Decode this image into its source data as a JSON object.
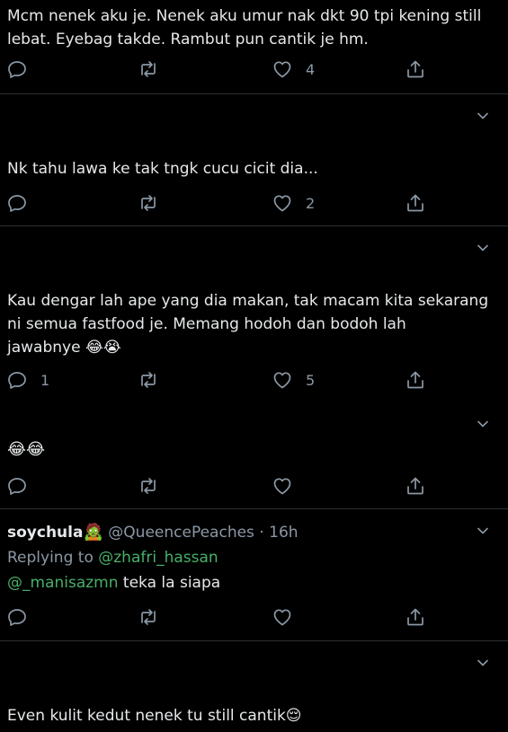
{
  "tweets": [
    {
      "lines": [
        "Mcm nenek aku je. Nenek aku umur nak dkt 90 tpi kening still",
        "lebat. Eyebag takde. Rambut pun cantik je hm."
      ],
      "reply_count": "",
      "like_count": "4"
    },
    {
      "lines": [
        "Nk tahu lawa ke tak tngk cucu cicit dia..."
      ],
      "reply_count": "",
      "like_count": "2"
    },
    {
      "lines": [
        "Kau dengar lah ape yang dia makan, tak macam kita sekarang",
        "ni semua fastfood je. Memang hodoh dan bodoh lah",
        "jawabnye 😂😭"
      ],
      "reply_count": "1",
      "like_count": "5"
    },
    {
      "lines": [
        "😂😂"
      ],
      "reply_count": "",
      "like_count": ""
    },
    {
      "author_name": "soychula",
      "author_badge": "🧟",
      "author_handle": "@QueencePeaches",
      "time": "· 16h",
      "replying_label": "Replying to",
      "replying_to": "@zhafri_hassan",
      "mention": "@_manisazmn",
      "body": " teka la siapa",
      "reply_count": "",
      "like_count": ""
    },
    {
      "lines": [
        "Even kulit kedut nenek tu still cantik😌"
      ]
    }
  ],
  "icons": {
    "reply": "reply-icon",
    "retweet": "retweet-icon",
    "like": "heart-icon",
    "share": "share-icon",
    "menu": "chevron-down-icon"
  },
  "colors": {
    "background": "#000000",
    "text": "#e6e8ea",
    "muted": "#8b98a5",
    "link": "#48b06a",
    "divider": "#2b2f33"
  }
}
